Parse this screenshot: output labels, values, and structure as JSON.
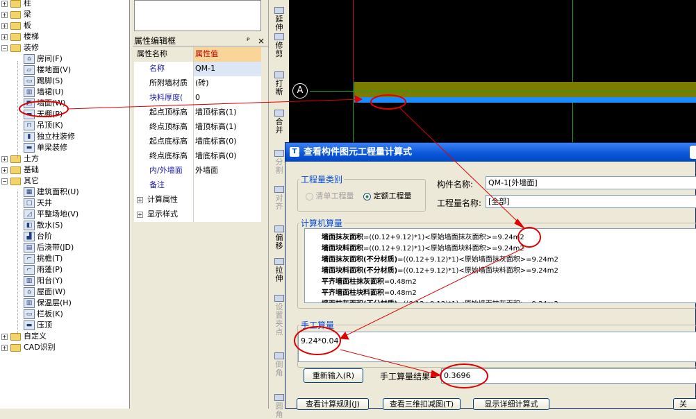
{
  "tree": {
    "items": [
      {
        "label": "柱",
        "type": "folder"
      },
      {
        "label": "梁",
        "type": "folder"
      },
      {
        "label": "板",
        "type": "folder"
      },
      {
        "label": "楼梯",
        "type": "folder"
      },
      {
        "label": "装修",
        "type": "folder-open"
      },
      {
        "label": "房间(F)",
        "type": "item",
        "icon": "room-icon"
      },
      {
        "label": "楼地面(V)",
        "type": "item",
        "icon": "floor-icon"
      },
      {
        "label": "踢脚(S)",
        "type": "item",
        "icon": "skirting-icon"
      },
      {
        "label": "墙裙(U)",
        "type": "item",
        "icon": "dado-icon"
      },
      {
        "label": "墙面(W)",
        "type": "item",
        "icon": "wall-surface-icon"
      },
      {
        "label": "天棚(P)",
        "type": "item",
        "icon": "ceiling-icon"
      },
      {
        "label": "吊顶(K)",
        "type": "item",
        "icon": "suspended-ceiling-icon"
      },
      {
        "label": "独立柱装修",
        "type": "item",
        "icon": "column-finish-icon"
      },
      {
        "label": "单梁装修",
        "type": "item",
        "icon": "beam-finish-icon"
      },
      {
        "label": "土方",
        "type": "folder"
      },
      {
        "label": "基础",
        "type": "folder"
      },
      {
        "label": "其它",
        "type": "folder-open"
      },
      {
        "label": "建筑面积(U)",
        "type": "item",
        "icon": "building-area-icon"
      },
      {
        "label": "天井",
        "type": "item",
        "icon": "courtyard-icon"
      },
      {
        "label": "平整场地(V)",
        "type": "item",
        "icon": "site-leveling-icon"
      },
      {
        "label": "散水(S)",
        "type": "item",
        "icon": "apron-icon"
      },
      {
        "label": "台阶",
        "type": "item",
        "icon": "steps-icon"
      },
      {
        "label": "后浇带(JD)",
        "type": "item",
        "icon": "post-cast-strip-icon"
      },
      {
        "label": "挑檐(T)",
        "type": "item",
        "icon": "eave-icon"
      },
      {
        "label": "雨蓬(P)",
        "type": "item",
        "icon": "canopy-icon"
      },
      {
        "label": "阳台(Y)",
        "type": "item",
        "icon": "balcony-icon"
      },
      {
        "label": "屋面(W)",
        "type": "item",
        "icon": "roof-icon"
      },
      {
        "label": "保温层(H)",
        "type": "item",
        "icon": "insulation-icon"
      },
      {
        "label": "栏板(K)",
        "type": "item",
        "icon": "parapet-icon"
      },
      {
        "label": "压顶",
        "type": "item",
        "icon": "coping-icon"
      },
      {
        "label": "自定义",
        "type": "folder"
      },
      {
        "label": "CAD识别",
        "type": "folder"
      }
    ]
  },
  "props": {
    "title": "属性编辑框",
    "pin": "ᴾ",
    "close": "×",
    "col_name": "属性名称",
    "col_value": "属性值",
    "rows": [
      {
        "name": "名称",
        "value": "QM-1",
        "blue": true
      },
      {
        "name": "所附墙材质",
        "value": "(砖)",
        "blue": false
      },
      {
        "name": "块料厚度(",
        "value": "0",
        "blue": true
      },
      {
        "name": "起点顶标高",
        "value": "墙顶标高(1)",
        "blue": false
      },
      {
        "name": "终点顶标高",
        "value": "墙顶标高(1)",
        "blue": false
      },
      {
        "name": "起点底标高",
        "value": "墙底标高(0)",
        "blue": false
      },
      {
        "name": "终点底标高",
        "value": "墙底标高(0)",
        "blue": false
      },
      {
        "name": "内/外墙面",
        "value": "外墙面",
        "blue": true
      },
      {
        "name": "备注",
        "value": "",
        "blue": true
      },
      {
        "name": "计算属性",
        "value": "",
        "expand": true
      },
      {
        "name": "显示样式",
        "value": "",
        "expand": true
      }
    ]
  },
  "vtools": [
    "延伸",
    "修剪",
    "打断",
    "合并",
    "分割",
    "对齐",
    "偏移",
    "拉伸",
    "设置夹点",
    "倒角",
    "圆角"
  ],
  "canvas": {
    "axis": "A"
  },
  "dialog": {
    "title": "查看构件图元工程量计算式",
    "qty_type_label": "工程量类别",
    "radio_list": "清单工程量",
    "radio_quota": "定额工程量",
    "comp_name_label": "构件名称:",
    "comp_name_value": "QM-1[外墙面]",
    "qty_name_label": "工程量名称:",
    "qty_name_value": "[全部]",
    "calc_label": "计算机算量",
    "calc_lines": [
      {
        "b": "墙面抹灰面积",
        "t": "=((0.12+9.12)*1)<原始墙面抹灰面积>=9.24m2"
      },
      {
        "b": "墙面块料面积",
        "t": "=((0.12+9.12)*1)<原始墙面块料面积>=9.24m2"
      },
      {
        "b": "墙面抹灰面积(不分材质)",
        "t": "=((0.12+9.12)*1)<原始墙面抹灰面积>=9.24m2"
      },
      {
        "b": "墙面块料面积(不分材质)",
        "t": "=((0.12+9.12)*1)<原始墙面块料面积>=9.24m2"
      },
      {
        "b": "平齐墙面柱抹灰面积",
        "t": "=0.48m2"
      },
      {
        "b": "平齐墙面柱块料面积",
        "t": "=0.48m2"
      },
      {
        "b": "墙面抹灰面积(不分材质)",
        "t": "=((0.12+9.12)*1)<原始墙面抹灰面积>=9.24m2"
      }
    ],
    "manual_label": "手工算量",
    "manual_value": "9.24*0.04",
    "reenter": "重新输入(R)",
    "manual_result_label": "手工算量结果=",
    "manual_result_value": "0.3696",
    "btn_rules": "查看计算规则(J)",
    "btn_3d": "查看三维扣减图(T)",
    "btn_detail": "显示详细计算式",
    "btn_close": "关"
  },
  "colors": {
    "annotation": "#e00000",
    "selection": "#316ac5",
    "title_blue": "#0a55d8"
  }
}
